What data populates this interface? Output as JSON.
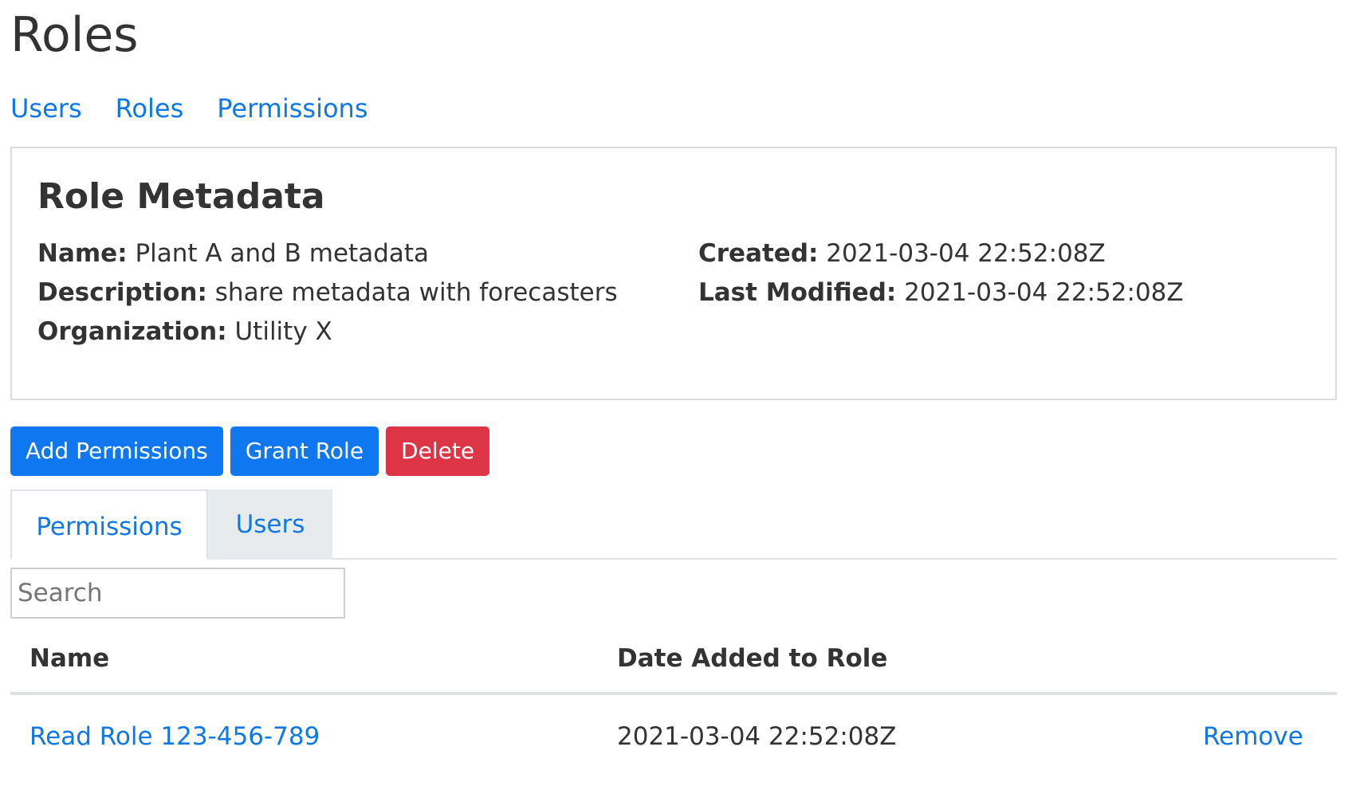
{
  "page": {
    "title": "Roles"
  },
  "nav": {
    "links": [
      "Users",
      "Roles",
      "Permissions"
    ]
  },
  "metadata": {
    "title": "Role Metadata",
    "name_label": "Name:",
    "name_value": "Plant A and B metadata",
    "description_label": "Description:",
    "description_value": "share metadata with forecasters",
    "organization_label": "Organization:",
    "organization_value": "Utility X",
    "created_label": "Created:",
    "created_value": "2021-03-04 22:52:08Z",
    "modified_label": "Last Modified:",
    "modified_value": "2021-03-04 22:52:08Z"
  },
  "actions": {
    "add_permissions": "Add Permissions",
    "grant_role": "Grant Role",
    "delete": "Delete"
  },
  "tabs": {
    "permissions": "Permissions",
    "users": "Users",
    "active": "permissions"
  },
  "search": {
    "placeholder": "Search",
    "value": ""
  },
  "table": {
    "headers": {
      "name": "Name",
      "date_added": "Date Added to Role"
    },
    "rows": [
      {
        "name": "Read Role 123-456-789",
        "date_added": "2021-03-04 22:52:08Z",
        "action": "Remove"
      }
    ]
  },
  "colors": {
    "link": "#0f78e6",
    "primary_button": "#0f78f1",
    "danger_button": "#dd3545",
    "inactive_tab": "#e8ebee",
    "text": "#333333"
  }
}
